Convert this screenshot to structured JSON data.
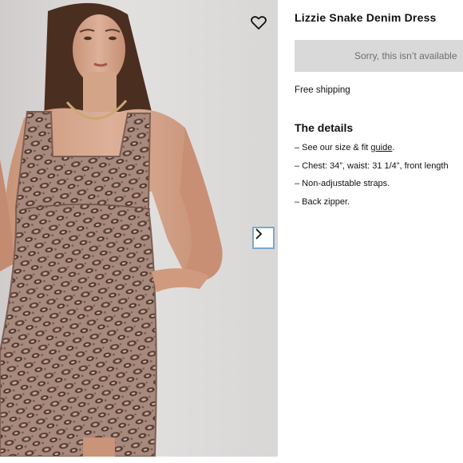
{
  "product": {
    "title": "Lizzie Snake Denim Dress",
    "availability_label": "Sorry, this isn’t available",
    "shipping": "Free shipping"
  },
  "details": {
    "heading": "The details",
    "items": [
      {
        "prefix": "– See our size & fit ",
        "link": "guide",
        "suffix": "."
      },
      {
        "prefix": "– Chest: 34”, waist: 31 1/4”, front length",
        "link": "",
        "suffix": ""
      },
      {
        "prefix": "– Non-adjustable straps.",
        "link": "",
        "suffix": ""
      },
      {
        "prefix": "– Back zipper.",
        "link": "",
        "suffix": ""
      }
    ]
  },
  "gallery": {
    "icons": {
      "favorite": "heart-icon",
      "next": "chevron-right-icon"
    },
    "colors": {
      "background": "#d9d7d6",
      "dress": "#a08579",
      "skin": "#d7a98e"
    }
  }
}
